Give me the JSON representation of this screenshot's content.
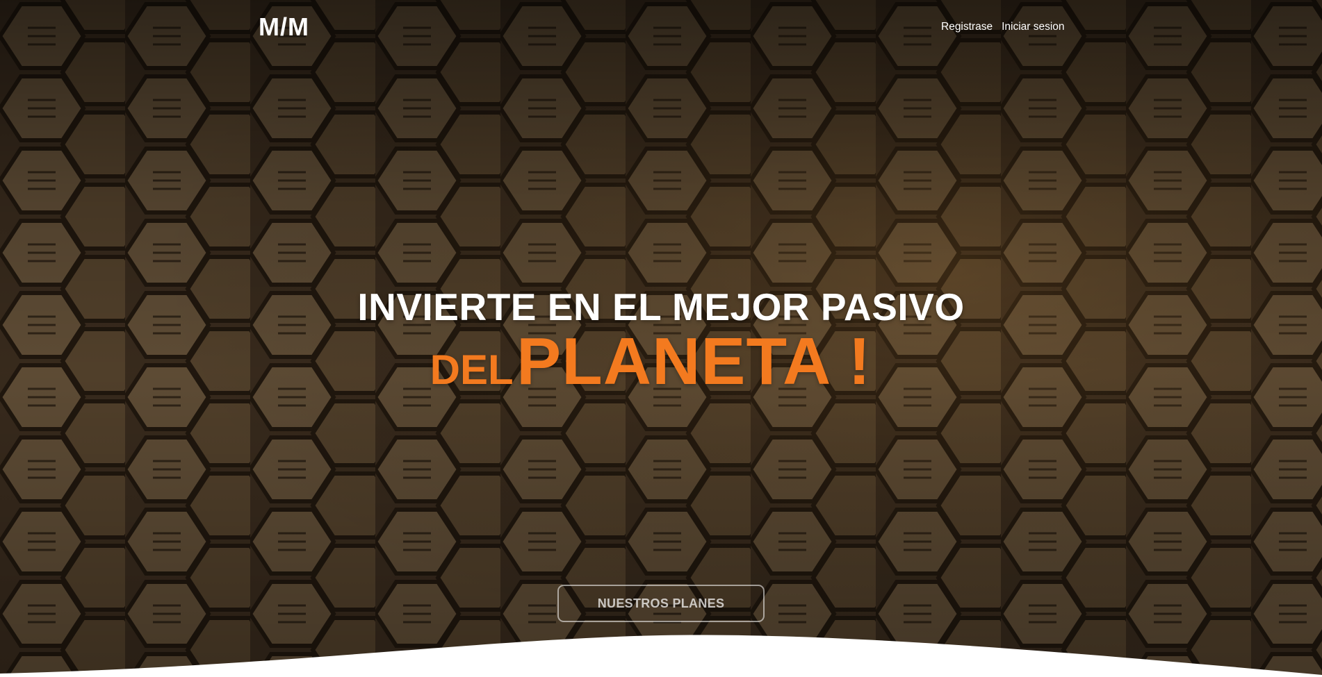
{
  "nav": {
    "logo": "M/M",
    "links": [
      {
        "label": "Registrase"
      },
      {
        "label": "Iniciar sesion"
      }
    ]
  },
  "hero": {
    "headline_line1": "INVIERTE EN EL MEJOR PASIVO",
    "headline_small": "DEL",
    "headline_big": "PLANETA !",
    "cta_label": "NUESTROS PLANES"
  },
  "colors": {
    "accent": "#f37a1f",
    "text": "#ffffff",
    "background": "#3a2c1c"
  },
  "background_image": "hexagonal-tiles"
}
